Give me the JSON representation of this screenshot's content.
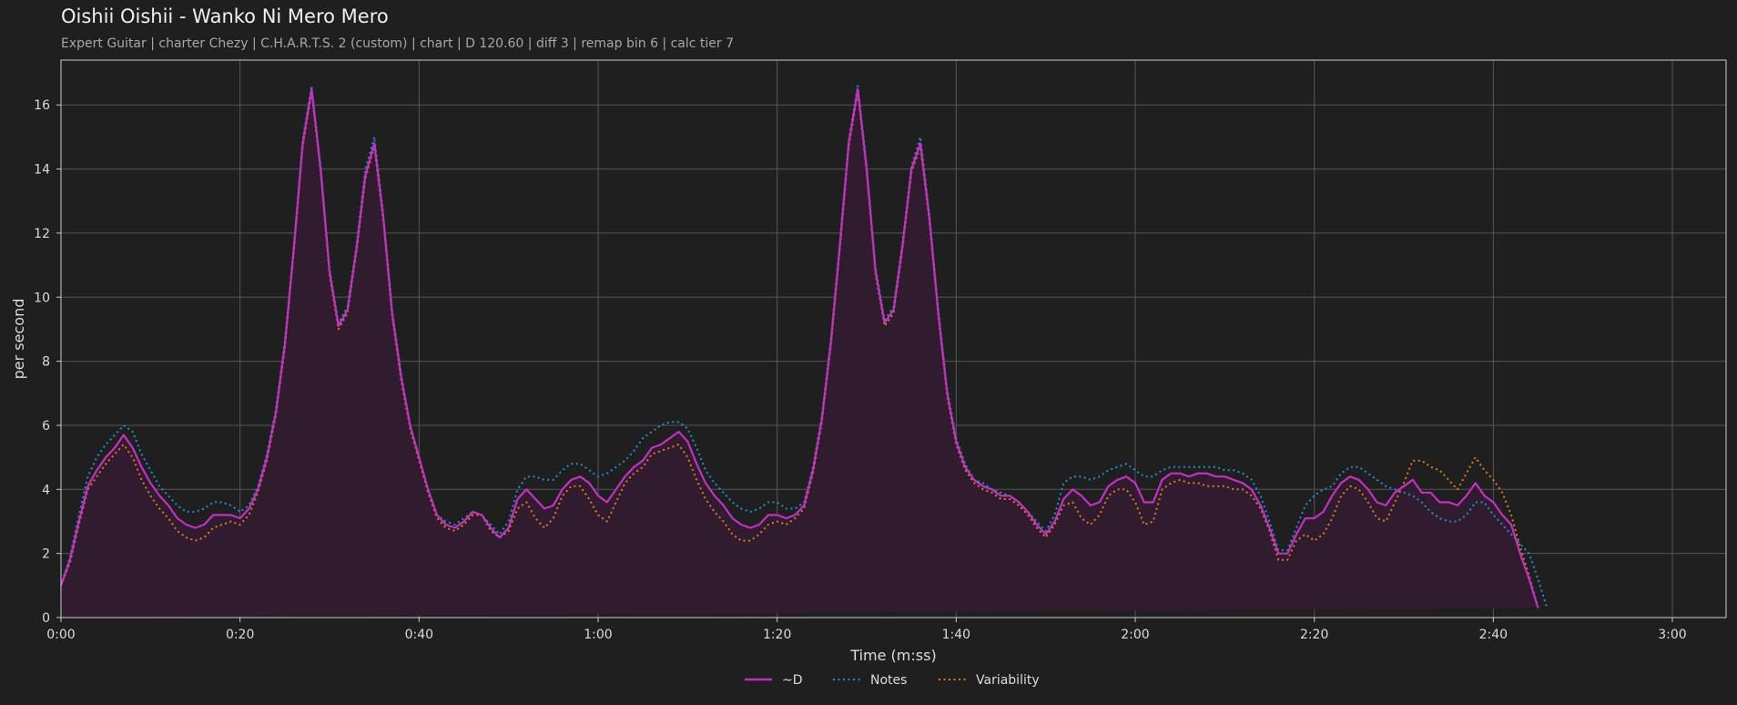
{
  "title": "Oishii Oishii - Wanko Ni Mero Mero",
  "subtitle": "Expert Guitar  |  charter Chezy  |  C.H.A.R.T.S. 2 (custom)  |  chart  |  D 120.60  |  diff 3  |  remap bin 6  |  calc tier 7",
  "colors": {
    "background": "#1f1f1f",
    "grid": "#555555",
    "axes": "#cccccc",
    "d_line": "#c42fc4",
    "notes_line": "#1f8fd0",
    "variability_line": "#e07a1f",
    "fill": "#301c2e"
  },
  "chart_data": {
    "type": "line",
    "title": "",
    "xlabel": "Time (m:ss)",
    "ylabel": "per second",
    "xlim": [
      0,
      186
    ],
    "ylim": [
      0,
      17.4
    ],
    "grid": true,
    "legend_position": "bottom-center",
    "x_ticks": [
      {
        "value": 0,
        "label": "0:00"
      },
      {
        "value": 20,
        "label": "0:20"
      },
      {
        "value": 40,
        "label": "0:40"
      },
      {
        "value": 60,
        "label": "1:00"
      },
      {
        "value": 80,
        "label": "1:20"
      },
      {
        "value": 100,
        "label": "1:40"
      },
      {
        "value": 120,
        "label": "2:00"
      },
      {
        "value": 140,
        "label": "2:20"
      },
      {
        "value": 160,
        "label": "2:40"
      },
      {
        "value": 180,
        "label": "3:00"
      }
    ],
    "y_ticks": [
      {
        "value": 0,
        "label": "0"
      },
      {
        "value": 2,
        "label": "2"
      },
      {
        "value": 4,
        "label": "4"
      },
      {
        "value": 6,
        "label": "6"
      },
      {
        "value": 8,
        "label": "8"
      },
      {
        "value": 10,
        "label": "10"
      },
      {
        "value": 12,
        "label": "12"
      },
      {
        "value": 14,
        "label": "14"
      },
      {
        "value": 16,
        "label": "16"
      }
    ],
    "x": [
      0,
      1,
      2,
      3,
      4,
      5,
      6,
      7,
      8,
      9,
      10,
      11,
      12,
      13,
      14,
      15,
      16,
      17,
      18,
      19,
      20,
      21,
      22,
      23,
      24,
      25,
      26,
      27,
      28,
      29,
      30,
      31,
      32,
      33,
      34,
      35,
      36,
      37,
      38,
      39,
      40,
      41,
      42,
      43,
      44,
      45,
      46,
      47,
      48,
      49,
      50,
      51,
      52,
      53,
      54,
      55,
      56,
      57,
      58,
      59,
      60,
      61,
      62,
      63,
      64,
      65,
      66,
      67,
      68,
      69,
      70,
      71,
      72,
      73,
      74,
      75,
      76,
      77,
      78,
      79,
      80,
      81,
      82,
      83,
      84,
      85,
      86,
      87,
      88,
      89,
      90,
      91,
      92,
      93,
      94,
      95,
      96,
      97,
      98,
      99,
      100,
      101,
      102,
      103,
      104,
      105,
      106,
      107,
      108,
      109,
      110,
      111,
      112,
      113,
      114,
      115,
      116,
      117,
      118,
      119,
      120,
      121,
      122,
      123,
      124,
      125,
      126,
      127,
      128,
      129,
      130,
      131,
      132,
      133,
      134,
      135,
      136,
      137,
      138,
      139,
      140,
      141,
      142,
      143,
      144,
      145,
      146,
      147,
      148,
      149,
      150,
      151,
      152,
      153,
      154,
      155,
      156,
      157,
      158,
      159,
      160,
      161,
      162,
      163,
      164,
      165,
      166,
      167,
      168,
      169,
      170,
      171,
      172,
      173,
      174,
      175,
      176,
      177,
      178,
      179,
      180,
      181,
      182,
      183,
      184,
      185,
      186
    ],
    "series": [
      {
        "name": "~D",
        "style": "solid",
        "values": [
          1.0,
          1.8,
          3.0,
          4.1,
          4.6,
          5.0,
          5.3,
          5.7,
          5.3,
          4.7,
          4.2,
          3.8,
          3.5,
          3.1,
          2.9,
          2.8,
          2.9,
          3.2,
          3.2,
          3.2,
          3.1,
          3.4,
          4.0,
          5.0,
          6.4,
          8.5,
          11.5,
          14.8,
          16.5,
          14.0,
          10.8,
          9.1,
          9.6,
          11.5,
          13.8,
          14.8,
          12.5,
          9.5,
          7.5,
          6.0,
          5.0,
          4.0,
          3.2,
          2.9,
          2.8,
          3.0,
          3.3,
          3.2,
          2.8,
          2.5,
          2.8,
          3.7,
          4.0,
          3.7,
          3.4,
          3.5,
          4.0,
          4.3,
          4.4,
          4.2,
          3.8,
          3.6,
          4.0,
          4.4,
          4.7,
          4.9,
          5.3,
          5.4,
          5.6,
          5.8,
          5.5,
          4.8,
          4.2,
          3.8,
          3.5,
          3.1,
          2.9,
          2.8,
          2.9,
          3.2,
          3.2,
          3.1,
          3.2,
          3.5,
          4.6,
          6.2,
          8.6,
          11.6,
          14.8,
          16.5,
          14.0,
          10.8,
          9.2,
          9.6,
          11.6,
          14.0,
          14.8,
          12.5,
          9.5,
          7.0,
          5.5,
          4.7,
          4.3,
          4.1,
          4.0,
          3.8,
          3.8,
          3.6,
          3.3,
          2.9,
          2.6,
          3.0,
          3.7,
          4.0,
          3.8,
          3.5,
          3.6,
          4.1,
          4.3,
          4.4,
          4.2,
          3.6,
          3.6,
          4.3,
          4.5,
          4.5,
          4.4,
          4.5,
          4.5,
          4.4,
          4.4,
          4.3,
          4.2,
          4.0,
          3.5,
          2.8,
          2.0,
          2.0,
          2.6,
          3.1,
          3.1,
          3.3,
          3.8,
          4.2,
          4.4,
          4.3,
          4.0,
          3.6,
          3.5,
          3.9,
          4.1,
          4.3,
          3.9,
          3.9,
          3.6,
          3.6,
          3.5,
          3.8,
          4.2,
          3.8,
          3.6,
          3.2,
          2.9,
          2.0,
          1.2,
          0.3
        ]
      },
      {
        "name": "Notes",
        "style": "dotted",
        "values": [
          1.0,
          1.9,
          3.2,
          4.4,
          5.0,
          5.4,
          5.7,
          6.0,
          5.8,
          5.1,
          4.6,
          4.1,
          3.8,
          3.5,
          3.3,
          3.3,
          3.4,
          3.6,
          3.6,
          3.5,
          3.3,
          3.5,
          4.1,
          5.1,
          6.5,
          8.6,
          11.6,
          14.9,
          16.6,
          14.1,
          10.9,
          9.2,
          9.7,
          11.6,
          14.0,
          15.0,
          12.6,
          9.6,
          7.6,
          6.0,
          5.0,
          4.0,
          3.2,
          3.0,
          2.9,
          3.1,
          3.3,
          3.2,
          2.9,
          2.6,
          3.0,
          4.0,
          4.4,
          4.4,
          4.3,
          4.3,
          4.6,
          4.8,
          4.8,
          4.6,
          4.4,
          4.5,
          4.7,
          4.9,
          5.2,
          5.6,
          5.8,
          6.0,
          6.1,
          6.1,
          5.9,
          5.3,
          4.6,
          4.2,
          3.9,
          3.6,
          3.4,
          3.3,
          3.4,
          3.6,
          3.6,
          3.4,
          3.4,
          3.6,
          4.7,
          6.3,
          8.7,
          11.7,
          14.9,
          16.6,
          14.1,
          10.9,
          9.3,
          9.7,
          11.7,
          14.1,
          15.0,
          12.6,
          9.6,
          7.1,
          5.6,
          4.8,
          4.3,
          4.2,
          4.0,
          3.9,
          3.8,
          3.6,
          3.3,
          3.0,
          2.7,
          3.2,
          4.2,
          4.4,
          4.4,
          4.3,
          4.4,
          4.6,
          4.7,
          4.8,
          4.6,
          4.4,
          4.4,
          4.6,
          4.7,
          4.7,
          4.7,
          4.7,
          4.7,
          4.7,
          4.6,
          4.6,
          4.5,
          4.3,
          3.8,
          3.0,
          2.1,
          2.1,
          2.8,
          3.5,
          3.8,
          4.0,
          4.1,
          4.5,
          4.7,
          4.7,
          4.5,
          4.3,
          4.1,
          4.0,
          3.9,
          3.8,
          3.6,
          3.3,
          3.1,
          3.0,
          3.0,
          3.2,
          3.6,
          3.6,
          3.2,
          2.9,
          2.6,
          2.3,
          2.0,
          1.2,
          0.3
        ]
      },
      {
        "name": "Variability",
        "style": "dotted",
        "values": [
          1.0,
          1.7,
          2.9,
          4.0,
          4.4,
          4.8,
          5.1,
          5.4,
          5.0,
          4.3,
          3.8,
          3.4,
          3.1,
          2.7,
          2.5,
          2.4,
          2.5,
          2.8,
          2.9,
          3.0,
          2.9,
          3.2,
          3.9,
          4.9,
          6.3,
          8.4,
          11.4,
          14.7,
          16.4,
          13.9,
          10.7,
          9.0,
          9.5,
          11.4,
          13.7,
          14.7,
          12.4,
          9.4,
          7.4,
          5.9,
          4.9,
          3.9,
          3.1,
          2.8,
          2.7,
          2.9,
          3.2,
          3.2,
          2.7,
          2.5,
          2.7,
          3.4,
          3.6,
          3.1,
          2.8,
          3.1,
          3.8,
          4.1,
          4.1,
          3.7,
          3.2,
          3.0,
          3.6,
          4.2,
          4.5,
          4.7,
          5.1,
          5.2,
          5.3,
          5.4,
          5.0,
          4.3,
          3.7,
          3.3,
          3.0,
          2.6,
          2.4,
          2.4,
          2.6,
          2.9,
          3.0,
          2.9,
          3.1,
          3.4,
          4.5,
          6.1,
          8.5,
          11.5,
          14.7,
          16.4,
          13.9,
          10.7,
          9.1,
          9.5,
          11.5,
          13.9,
          14.7,
          12.4,
          9.4,
          6.9,
          5.4,
          4.6,
          4.2,
          4.0,
          3.9,
          3.7,
          3.7,
          3.5,
          3.2,
          2.8,
          2.5,
          2.9,
          3.5,
          3.6,
          3.1,
          2.9,
          3.2,
          3.8,
          4.0,
          4.0,
          3.6,
          2.9,
          3.0,
          4.0,
          4.2,
          4.3,
          4.2,
          4.2,
          4.1,
          4.1,
          4.1,
          4.0,
          4.0,
          3.8,
          3.4,
          2.7,
          1.8,
          1.8,
          2.4,
          2.6,
          2.4,
          2.6,
          3.1,
          3.8,
          4.1,
          4.0,
          3.6,
          3.1,
          3.0,
          3.6,
          4.2,
          4.9,
          4.9,
          4.7,
          4.6,
          4.3,
          4.0,
          4.5,
          5.0,
          4.6,
          4.3,
          3.9,
          3.2,
          2.2,
          1.3,
          0.3
        ]
      }
    ]
  }
}
